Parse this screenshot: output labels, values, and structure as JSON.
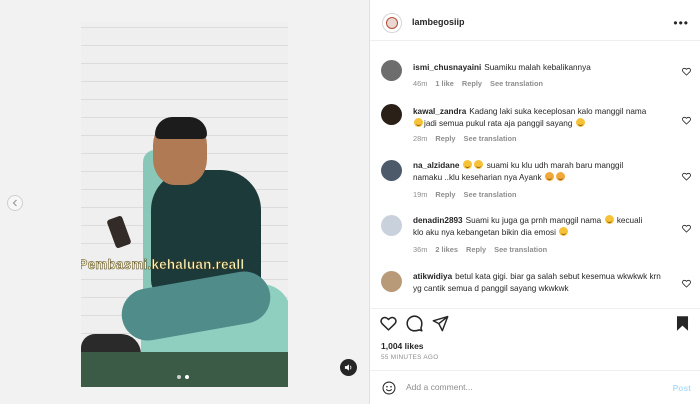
{
  "post": {
    "username": "lambegosiip",
    "watermark_text": "@Pembasmi.kehaluan.reall",
    "likes": "1,004 likes",
    "time_ago": "55 MINUTES AGO",
    "add_comment_placeholder": "Add a comment...",
    "post_label": "Post"
  },
  "comments": [
    {
      "user": "ismi_chusnayaini",
      "text": "Suamiku malah kebalikannya",
      "time": "46m",
      "likes": "1 like",
      "reply": "Reply",
      "translate": "See translation",
      "avatar_color": "#6d6d6d"
    },
    {
      "user": "kawal_zandra",
      "text_a": "Kadang laki suka keceplosan kalo manggil nama",
      "text_b": "jadi semua pukul rata aja panggil sayang",
      "time": "28m",
      "reply": "Reply",
      "translate": "See translation",
      "avatar_color": "#2a2018"
    },
    {
      "user": "na_alzidane",
      "text_a": "suami ku klu udh marah baru manggil",
      "text_b": "namaku ..klu keseharian nya Ayank",
      "time": "19m",
      "reply": "Reply",
      "translate": "See translation",
      "avatar_color": "#4c5a6a"
    },
    {
      "user": "denadin2893",
      "text_a": "Suami ku juga ga prnh manggil nama",
      "text_b": "kecuali",
      "text_c": "klo aku nya kebangetan bikin dia emosi",
      "time": "36m",
      "likes": "2 likes",
      "reply": "Reply",
      "translate": "See translation",
      "avatar_color": "#c9d2dc"
    },
    {
      "user": "atikwidiya",
      "text": "betul kata gigi. biar ga salah sebut kesemua wkwkwk krn yg cantik semua d panggil sayang wkwkwk",
      "avatar_color": "#b89a78"
    }
  ],
  "icons": {
    "like": "heart-icon",
    "comment": "comment-icon",
    "share": "paper-plane-icon",
    "save": "bookmark-icon",
    "emoji": "smiley-icon",
    "sound": "speaker-icon",
    "prev": "chevron-left-icon"
  }
}
